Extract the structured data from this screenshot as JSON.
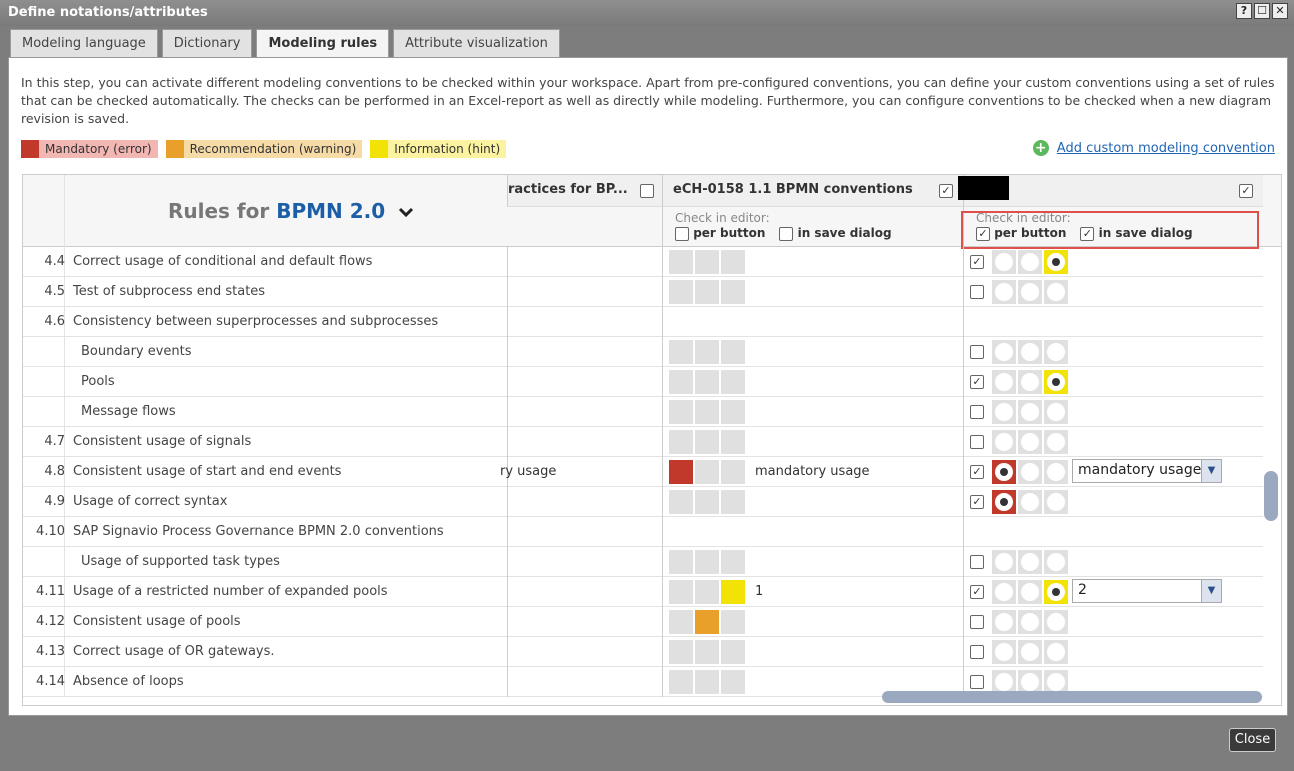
{
  "window": {
    "title": "Define notations/attributes",
    "help_btn": "?",
    "max_btn": "☐",
    "close_btn": "✕"
  },
  "tabs": [
    "Modeling language",
    "Dictionary",
    "Modeling rules",
    "Attribute visualization"
  ],
  "intro": "In this step, you can activate different modeling conventions to be checked within your workspace. Apart from pre-configured conventions, you can define your custom conventions using a set of rules that can be checked automatically. The checks can be performed in an Excel-report as well as directly while modeling. Furthermore, you can configure conventions to be checked when a new diagram revision is saved.",
  "legend": {
    "mandatory": "Mandatory (error)",
    "recommendation": "Recommendation (warning)",
    "information": "Information (hint)"
  },
  "add_convention": "Add custom modeling convention",
  "grid": {
    "rules_for": "Rules for",
    "language": "BPMN 2.0",
    "col1_title": "ractices for BP...",
    "col2_title": "eCH-0158 1.1 BPMN conventions",
    "check_in_editor": "Check in editor:",
    "per_button": "per button",
    "in_save_dialog": "in save dialog"
  },
  "rows": [
    {
      "num": "4.4",
      "name": "Correct usage of conditional and default flows",
      "sub": false,
      "c1": "",
      "c2sq": [
        0,
        0,
        0
      ],
      "c2text": "",
      "cb": true,
      "circ": "2",
      "sel": ""
    },
    {
      "num": "4.5",
      "name": "Test of subprocess end states",
      "sub": false,
      "c1": "",
      "c2sq": [
        0,
        0,
        0
      ],
      "c2text": "",
      "cb": false,
      "circ": "",
      "sel": ""
    },
    {
      "num": "4.6",
      "name": "Consistency between superprocesses and subprocesses",
      "sub": false,
      "c1": "",
      "c2sq": null,
      "c2text": "",
      "cb": null,
      "circ": "",
      "sel": ""
    },
    {
      "num": "",
      "name": "Boundary events",
      "sub": true,
      "c1": "",
      "c2sq": [
        0,
        0,
        0
      ],
      "c2text": "",
      "cb": false,
      "circ": "",
      "sel": ""
    },
    {
      "num": "",
      "name": "Pools",
      "sub": true,
      "c1": "",
      "c2sq": [
        0,
        0,
        0
      ],
      "c2text": "",
      "cb": true,
      "circ": "2",
      "sel": ""
    },
    {
      "num": "",
      "name": "Message flows",
      "sub": true,
      "c1": "",
      "c2sq": [
        0,
        0,
        0
      ],
      "c2text": "",
      "cb": false,
      "circ": "",
      "sel": ""
    },
    {
      "num": "4.7",
      "name": "Consistent usage of signals",
      "sub": false,
      "c1": "",
      "c2sq": [
        0,
        0,
        0
      ],
      "c2text": "",
      "cb": false,
      "circ": "",
      "sel": ""
    },
    {
      "num": "4.8",
      "name": "Consistent usage of start and end events",
      "sub": false,
      "c1": "ry usage",
      "c2sq": [
        1,
        0,
        0
      ],
      "c2text": "mandatory usage",
      "cb": true,
      "circ": "0",
      "sel": "mandatory usage"
    },
    {
      "num": "4.9",
      "name": "Usage of correct syntax",
      "sub": false,
      "c1": "",
      "c2sq": [
        0,
        0,
        0
      ],
      "c2text": "",
      "cb": true,
      "circ": "0",
      "sel": ""
    },
    {
      "num": "4.10",
      "name": "SAP Signavio Process Governance BPMN 2.0 conventions",
      "sub": false,
      "c1": "",
      "c2sq": null,
      "c2text": "",
      "cb": null,
      "circ": "",
      "sel": ""
    },
    {
      "num": "",
      "name": "Usage of supported task types",
      "sub": true,
      "c1": "",
      "c2sq": [
        0,
        0,
        0
      ],
      "c2text": "",
      "cb": false,
      "circ": "",
      "sel": ""
    },
    {
      "num": "4.11",
      "name": "Usage of a restricted number of expanded pools",
      "sub": false,
      "c1": "",
      "c2sq": [
        0,
        0,
        3
      ],
      "c2text": "1",
      "cb": true,
      "circ": "2",
      "sel": "2"
    },
    {
      "num": "4.12",
      "name": "Consistent usage of pools",
      "sub": false,
      "c1": "",
      "c2sq": [
        0,
        2,
        0
      ],
      "c2text": "",
      "cb": false,
      "circ": "",
      "sel": ""
    },
    {
      "num": "4.13",
      "name": "Correct usage of OR gateways.",
      "sub": false,
      "c1": "",
      "c2sq": [
        0,
        0,
        0
      ],
      "c2text": "",
      "cb": false,
      "circ": "",
      "sel": ""
    },
    {
      "num": "4.14",
      "name": "Absence of loops",
      "sub": false,
      "c1": "",
      "c2sq": [
        0,
        0,
        0
      ],
      "c2text": "",
      "cb": false,
      "circ": "",
      "sel": ""
    }
  ],
  "close_label": "Close",
  "colors": {
    "error": "#c0392b",
    "warning": "#e8a02a",
    "hint": "#f2e205",
    "link": "#2165b5"
  }
}
